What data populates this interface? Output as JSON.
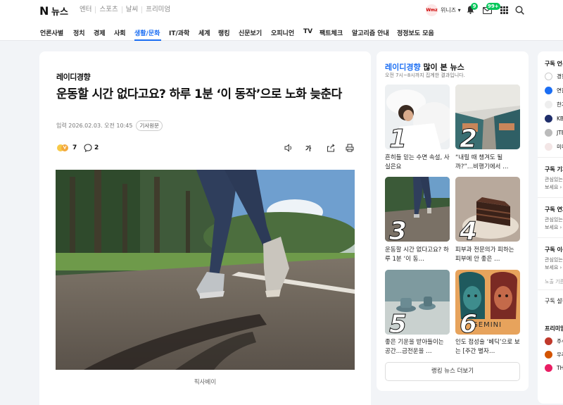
{
  "header": {
    "logo_n": "N",
    "logo_news": "뉴스",
    "top_links": [
      "엔터",
      "스포츠",
      "날씨",
      "프리미엄"
    ],
    "user_avatar": "Wmz",
    "user_name": "위니즈 ▾",
    "notif_count": "9",
    "mail_count": "99+"
  },
  "nav": {
    "items": [
      "언론사별",
      "정치",
      "경제",
      "사회",
      "생활/문화",
      "IT/과학",
      "세계",
      "랭킹",
      "신문보기",
      "오피니언",
      "TV",
      "팩트체크",
      "알고리즘 안내",
      "정정보도 모음"
    ],
    "active": "생활/문화"
  },
  "article": {
    "press": "레이디경향",
    "headline": "운동할 시간 없다고요? 하루 1분 ‘이 동작’으로 노화 늦춘다",
    "date": "입력 2026.02.03. 오전 10:45",
    "original_btn": "기사원문",
    "reaction_count": "7",
    "comment_count": "2",
    "font_btn": "가",
    "caption": "픽사베이"
  },
  "ranking": {
    "press": "레이디경향",
    "title_suffix": " 많이 본 뉴스",
    "subtitle": "오전 7시~8시까지 집계한 결과입니다.",
    "items": [
      {
        "rank": "1",
        "text": "흔히들 믿는 수면 속설, 사실은요"
      },
      {
        "rank": "2",
        "text": "“내릴 때 챙겨도 될까?”…비행기에서 …"
      },
      {
        "rank": "3",
        "text": "운동할 시간 없다고요? 하루 1분 ‘이 동…"
      },
      {
        "rank": "4",
        "text": "피부과 전문의가 피하는 피부에 안 좋은 …"
      },
      {
        "rank": "5",
        "text": "좋은 기운을 받아들이는 공간…금전운을 …"
      },
      {
        "rank": "6",
        "text": "인도 점성술 ‘베딕’으로 보는 [주간 별자…"
      }
    ],
    "thumb_gemini": "GEMINI",
    "more_label": "랭킹 뉴스 더보기"
  },
  "subscribe": {
    "title1": "구독 언론",
    "rows1": [
      "경향",
      "연합",
      "한겨",
      "KBS",
      "JTBC",
      "미디"
    ],
    "title2": "구독 기자",
    "sub2": [
      "관심있는",
      "보세요 ›"
    ],
    "title3": "구독 연재",
    "sub3": [
      "관심있는",
      "보세요 ›"
    ],
    "title4": "구독 이슈",
    "sub4": [
      "관심있는",
      "보세요 ›"
    ],
    "note": "노출 기준",
    "title5": "구독 설정",
    "title6": "프리미엄",
    "rows6": [
      "주식",
      "우리",
      "THE"
    ]
  },
  "colors": {
    "accent": "#1b6ef3",
    "badge_green": "#03c75a"
  }
}
